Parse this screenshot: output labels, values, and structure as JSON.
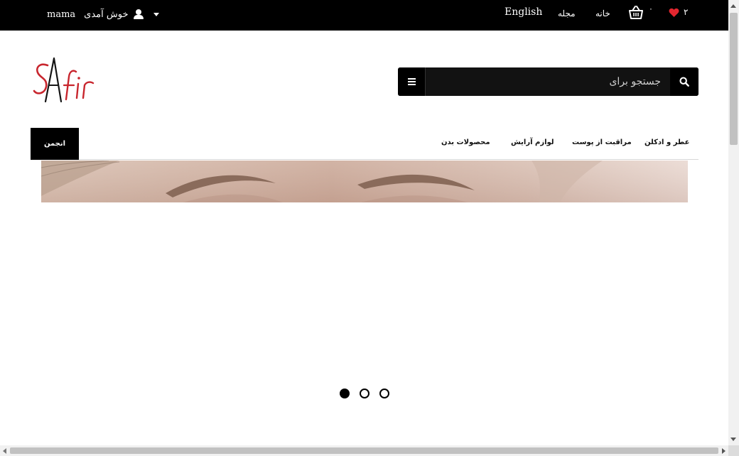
{
  "topbar": {
    "user_name": "mama",
    "greeting": "خوش آمدی",
    "language": "English",
    "magazine": "مجله",
    "home": "خانه",
    "cart_count": "۰",
    "wishlist_count": "۲",
    "background": "#000000",
    "heart_color": "#e3262f"
  },
  "logo": {
    "text": "SAfir",
    "primary_color": "#c8262e"
  },
  "search": {
    "placeholder": "جستجو برای"
  },
  "nav": {
    "community": "انجمن",
    "categories": [
      {
        "label": "عطر و ادکلن"
      },
      {
        "label": "مراقبت از پوست"
      },
      {
        "label": "لوازم آرایش"
      },
      {
        "label": "محصولات بدن"
      }
    ]
  },
  "slider": {
    "total": 3,
    "active": 1
  }
}
